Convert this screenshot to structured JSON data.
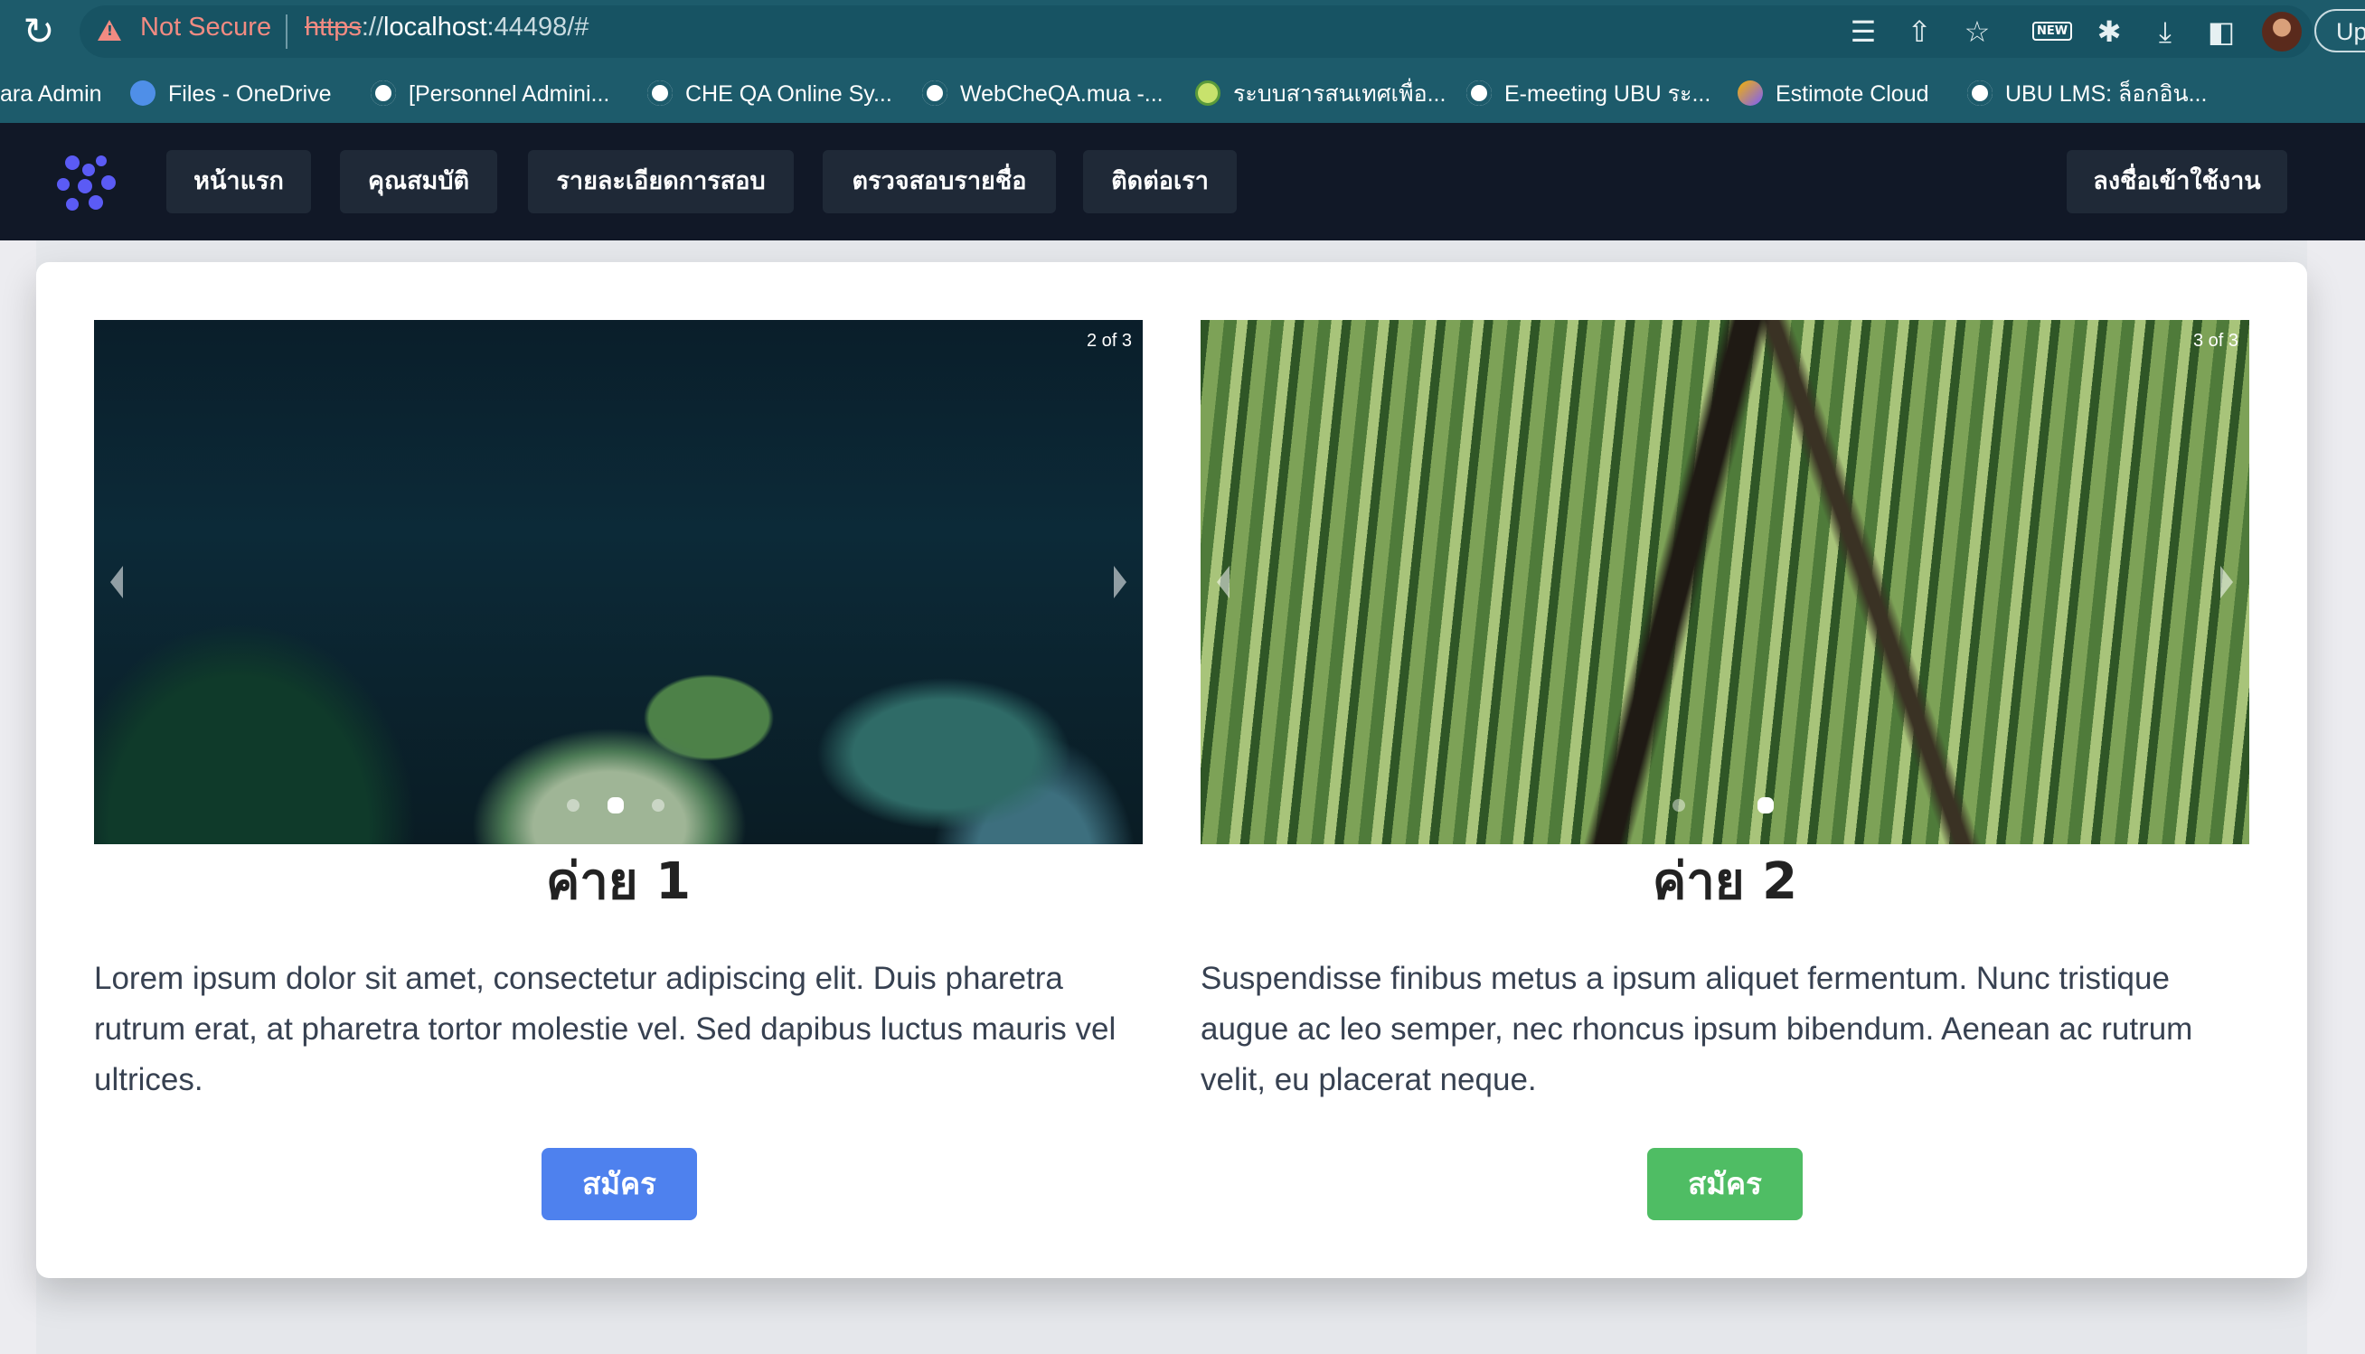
{
  "browser": {
    "not_secure": "Not Secure",
    "url_scheme": "https",
    "url_rest": "://",
    "url_host": "localhost",
    "url_path": ":44498/#",
    "update_label": "Up",
    "bookmarks": [
      {
        "label": "ara Admin",
        "icon": "none"
      },
      {
        "label": "Files - OneDrive",
        "icon": "onedrive-icon"
      },
      {
        "label": "[Personnel Admini...",
        "icon": "globe-icon"
      },
      {
        "label": "CHE QA Online Sy...",
        "icon": "globe-icon"
      },
      {
        "label": "WebCheQA.mua -...",
        "icon": "globe-icon"
      },
      {
        "label": "ระบบสารสนเทศเพื่อ...",
        "icon": "seal-icon"
      },
      {
        "label": "E-meeting UBU ระ...",
        "icon": "globe-icon"
      },
      {
        "label": "Estimote Cloud",
        "icon": "estimote-icon"
      },
      {
        "label": "UBU LMS: ล็อกอิน...",
        "icon": "globe-icon"
      }
    ]
  },
  "navbar": {
    "items": [
      "หน้าแรก",
      "คุณสมบัติ",
      "รายละเอียดการสอบ",
      "ตรวจสอบรายชื่อ",
      "ติดต่อเรา"
    ],
    "login": "ลงชื่อเข้าใช้งาน"
  },
  "camps": [
    {
      "counter": "2 of 3",
      "title": "ค่าย 1",
      "description": "Lorem ipsum dolor sit amet, consectetur adipiscing elit. Duis pharetra rutrum erat, at pharetra tortor molestie vel. Sed dapibus luctus mauris vel ultrices.",
      "button": "สมัคร",
      "button_color": "#4e81ee"
    },
    {
      "counter": "3 of 3",
      "title": "ค่าย 2",
      "description": "Suspendisse finibus metus a ipsum aliquet fermentum. Nunc tristique augue ac leo semper, nec rhoncus ipsum bibendum. Aenean ac rutrum velit, eu placerat neque.",
      "button": "สมัคร",
      "button_color": "#4fbd64"
    }
  ]
}
